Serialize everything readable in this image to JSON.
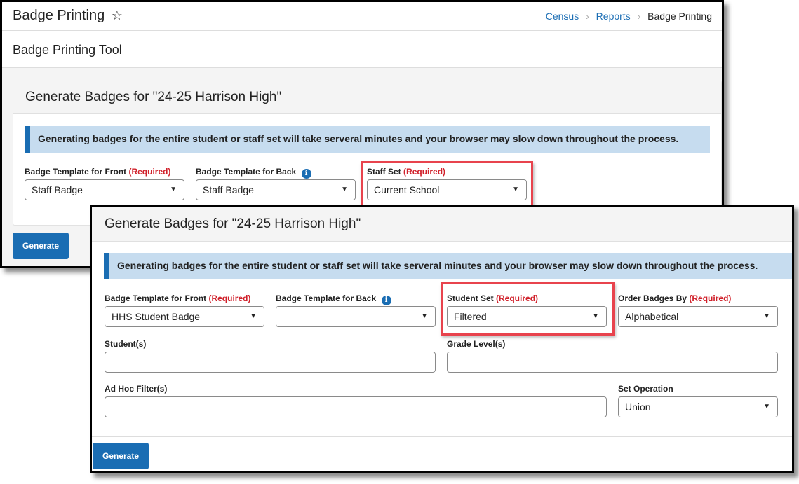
{
  "screen1": {
    "page_title": "Badge Printing",
    "favorite_icon": "star-outline-icon",
    "breadcrumb": [
      {
        "label": "Census",
        "link": true
      },
      {
        "label": "Reports",
        "link": true
      },
      {
        "label": "Badge Printing",
        "link": false
      }
    ],
    "subheader_title": "Badge Printing Tool",
    "panel_title": "Generate Badges for \"24-25 Harrison High\"",
    "notice": "Generating badges for the entire student or staff set will take serveral minutes and your browser may slow down throughout the process.",
    "fields": {
      "front_label": "Badge Template for Front",
      "front_value": "Staff Badge",
      "back_label": "Badge Template for Back",
      "back_value": "Staff Badge",
      "set_label": "Staff Set",
      "set_value": "Current School"
    },
    "required_text": "(Required)",
    "generate_label": "Generate"
  },
  "screen2": {
    "panel_title": "Generate Badges for \"24-25 Harrison High\"",
    "notice": "Generating badges for the entire student or staff set will take serveral minutes and your browser may slow down throughout the process.",
    "fields": {
      "front_label": "Badge Template for Front",
      "front_value": "HHS Student Badge",
      "back_label": "Badge Template for Back",
      "back_value": "",
      "set_label": "Student Set",
      "set_value": "Filtered",
      "order_label": "Order Badges By",
      "order_value": "Alphabetical",
      "students_label": "Student(s)",
      "students_value": "",
      "grades_label": "Grade Level(s)",
      "grades_value": "",
      "adhoc_label": "Ad Hoc Filter(s)",
      "adhoc_value": "",
      "setop_label": "Set Operation",
      "setop_value": "Union"
    },
    "required_text": "(Required)",
    "generate_label": "Generate"
  },
  "icons": {
    "info": "i",
    "caret": "▼",
    "star": "☆",
    "breadcrumb_sep": "›"
  },
  "colors": {
    "accent": "#1a6db3",
    "required": "#d0202a",
    "highlight": "#e8434d",
    "notice_bg": "#c6dcef"
  }
}
